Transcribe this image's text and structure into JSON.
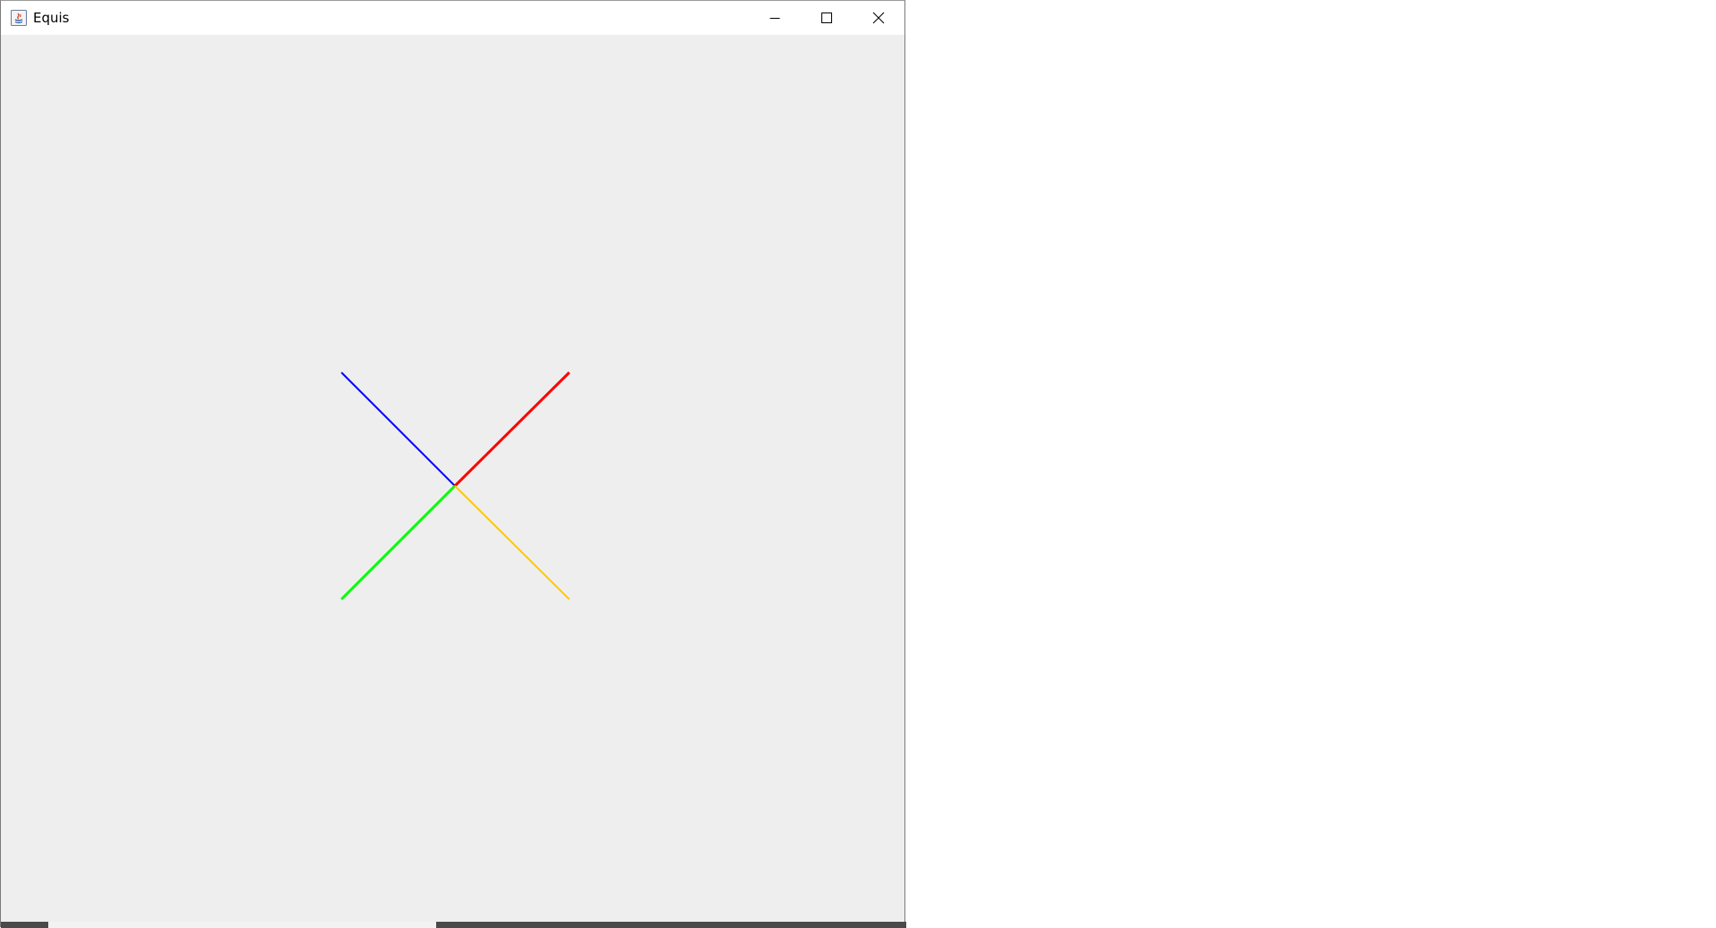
{
  "window": {
    "title": "Equis",
    "controls": {
      "minimize_icon": "minimize-icon",
      "maximize_icon": "maximize-icon",
      "close_icon": "close-icon"
    }
  },
  "canvas": {
    "background": "#eeeeee",
    "lines": [
      {
        "name": "blue-line",
        "color": "#0000ff"
      },
      {
        "name": "red-line",
        "color": "#ff0000"
      },
      {
        "name": "green-line",
        "color": "#00ff00"
      },
      {
        "name": "orange-line",
        "color": "#ffc800"
      }
    ]
  }
}
